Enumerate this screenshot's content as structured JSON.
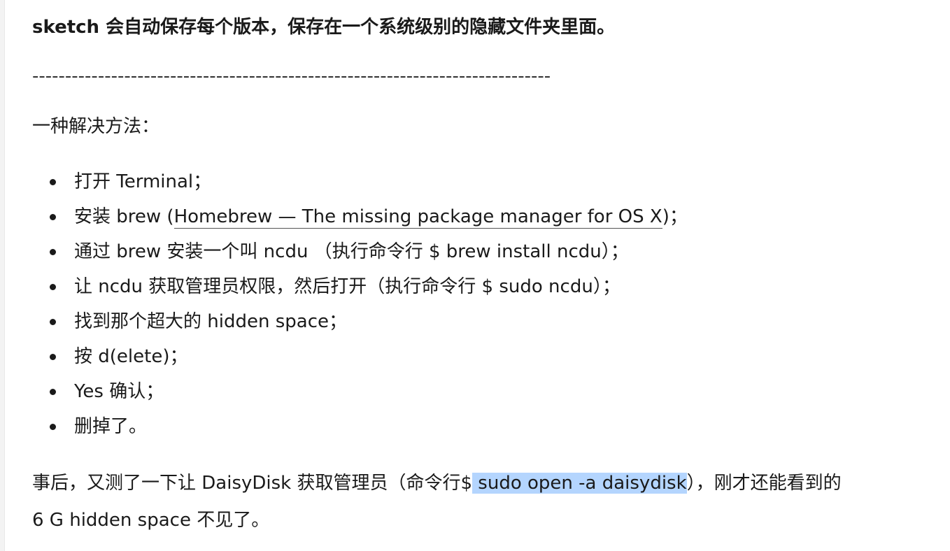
{
  "lead": "sketch 会自动保存每个版本，保存在一个系统级别的隐藏文件夹里面。",
  "divider": "-------------------------------------------------------------------------------",
  "method_heading": "一种解决方法：",
  "steps": [
    {
      "text": "打开 Terminal；"
    },
    {
      "before": "安装 brew (",
      "link": "Homebrew — The missing package manager for OS X",
      "after": ")；"
    },
    {
      "text": "通过 brew 安装一个叫 ncdu （执行命令行 $ brew install ncdu）；"
    },
    {
      "text": "让 ncdu 获取管理员权限，然后打开（执行命令行 $ sudo ncdu）；"
    },
    {
      "text": "找到那个超大的 hidden space；"
    },
    {
      "text": "按 d(elete)；"
    },
    {
      "text": "Yes 确认；"
    },
    {
      "text": "删掉了。"
    }
  ],
  "after": {
    "line1_before": "事后，又测了一下让 DaisyDisk 获取管理员（命令行$",
    "line1_highlight": " sudo open -a daisydisk",
    "line1_after": "），刚才还能看到的",
    "line2": "6 G hidden space 不见了。"
  },
  "colors": {
    "selection_highlight": "#b4d5fe",
    "text": "#1a1a1a"
  }
}
